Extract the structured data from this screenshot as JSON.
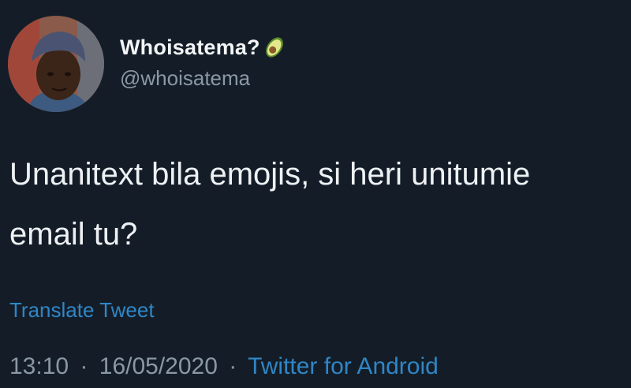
{
  "user": {
    "display_name": "Whoisatema?",
    "name_emoji": "avocado-icon",
    "handle": "@whoisatema"
  },
  "tweet": {
    "text_line1": "Unanitext bila emojis, si heri unitumie",
    "text_line2": "email tu?"
  },
  "actions": {
    "translate_label": "Translate Tweet"
  },
  "meta": {
    "time": "13:10",
    "separator": "·",
    "date": "16/05/2020",
    "source": "Twitter for Android"
  },
  "colors": {
    "background": "#141d27",
    "link": "#2f86c6",
    "secondary_text": "#8a98a5"
  }
}
